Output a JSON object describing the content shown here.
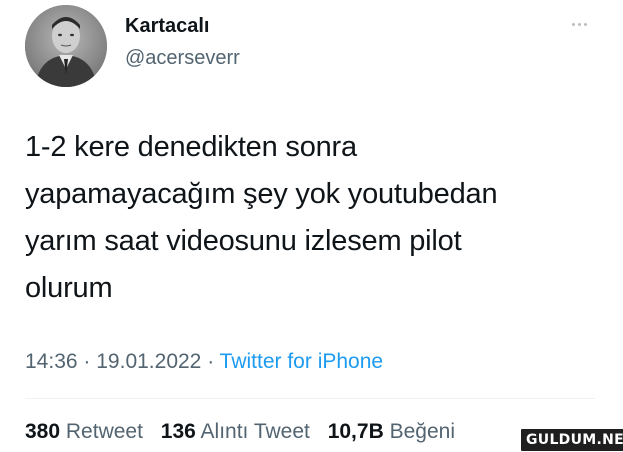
{
  "author": {
    "name": "Kartacalı",
    "handle": "@acerseverr",
    "avatar_icon": "profile-photo"
  },
  "tweet": {
    "text": "1-2 kere denedikten sonra\nyapamayacağım şey yok youtubedan\nyarım saat videosunu izlesem pilot\nolurum"
  },
  "meta": {
    "time": "14:36",
    "separator": "·",
    "date": "19.01.2022",
    "source": "Twitter for iPhone"
  },
  "stats": {
    "retweets_count": "380",
    "retweets_label": "Retweet",
    "quotes_count": "136",
    "quotes_label": "Alıntı Tweet",
    "likes_count": "10,7B",
    "likes_label": "Beğeni"
  },
  "watermark": {
    "text": "GULDUM.NET"
  },
  "colors": {
    "text_primary": "#0f1419",
    "text_secondary": "#536471",
    "link": "#1d9bf0"
  },
  "icons": {
    "more": "more-icon"
  }
}
